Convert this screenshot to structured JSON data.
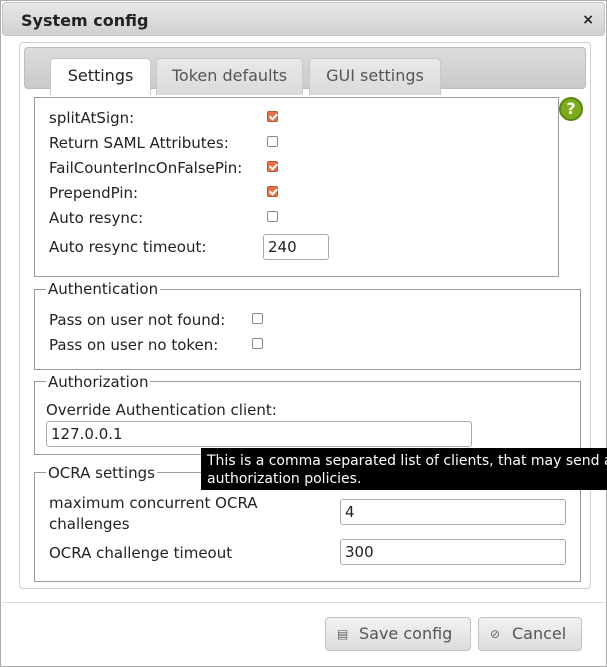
{
  "dialog": {
    "title": "System config",
    "close_glyph": "×"
  },
  "tabs": [
    {
      "label": "Settings",
      "active": true
    },
    {
      "label": "Token defaults",
      "active": false
    },
    {
      "label": "GUI settings",
      "active": false
    }
  ],
  "settings": {
    "split_at_sign": {
      "label": "splitAtSign:",
      "checked": true
    },
    "return_saml": {
      "label": "Return SAML Attributes:",
      "checked": false
    },
    "fail_counter": {
      "label": "FailCounterIncOnFalsePin:",
      "checked": true
    },
    "prepend_pin": {
      "label": "PrependPin:",
      "checked": true
    },
    "auto_resync": {
      "label": "Auto resync:",
      "checked": false
    },
    "auto_resync_timeout": {
      "label": "Auto resync timeout:",
      "value": "240"
    }
  },
  "authentication": {
    "legend": "Authentication",
    "pass_not_found": {
      "label": "Pass on user not found:",
      "checked": false
    },
    "pass_no_token": {
      "label": "Pass on user no token:",
      "checked": false
    }
  },
  "authorization": {
    "legend": "Authorization",
    "override_label": "Override Authentication client:",
    "override_value": "127.0.0.1"
  },
  "tooltip": {
    "line1": "This is a comma separated list of clients, that may send anot",
    "line2": "authorization policies."
  },
  "ocra": {
    "legend": "OCRA settings",
    "max_challenges_label_line1": "maximum concurrent OCRA",
    "max_challenges_label_line2": "challenges",
    "max_challenges_value": "4",
    "timeout_label": "OCRA challenge timeout",
    "timeout_value": "300"
  },
  "buttons": {
    "save": "Save config",
    "cancel": "Cancel"
  },
  "icons": {
    "help": "help-icon",
    "save": "disk-icon",
    "cancel": "cancel-icon"
  },
  "colors": {
    "checkbox_checked": "#e8734a",
    "help_icon": "#7dab1e",
    "tooltip_bg": "#000000"
  }
}
